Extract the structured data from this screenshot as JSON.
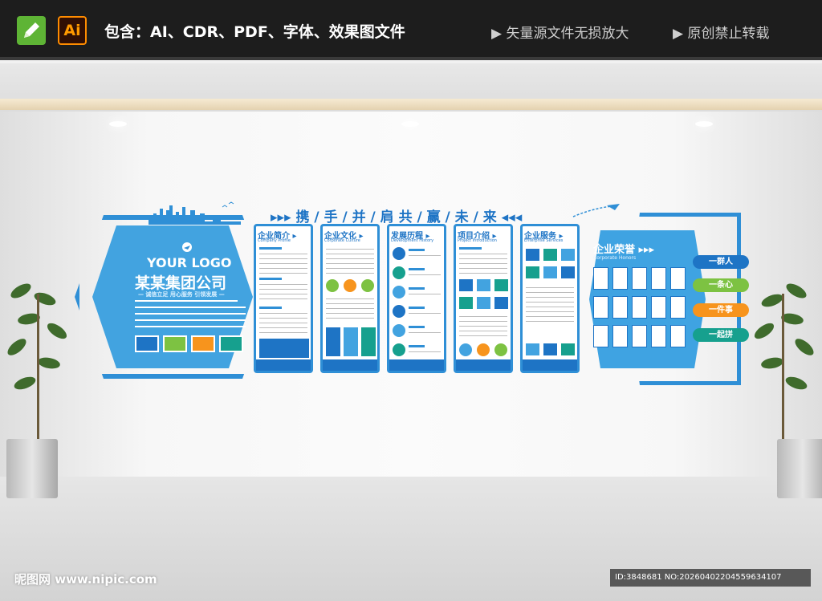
{
  "topbar": {
    "app_icon": "pen-icon",
    "ai_badge": "Ai",
    "includes_text": "包含：AI、CDR、PDF、字体、效果图文件",
    "note1": "▶ 矢量源文件无损放大",
    "note2": "▶ 原创禁止转载"
  },
  "wall": {
    "slogan_title": "▸▸▸ 携 / 手 / 并 / 肩 共 / 赢 / 未 / 来 ◂◂◂",
    "logo_text": "YOUR LOGO",
    "company_name": "某某集团公司",
    "company_slogan": "— 诚信立足 用心服务 引领发展 —",
    "panels": [
      {
        "title": "企业简介 ▸",
        "subtitle": "Company Profile"
      },
      {
        "title": "企业文化 ▸",
        "subtitle": "Corporate Culture"
      },
      {
        "title": "发展历程 ▸",
        "subtitle": "Development History"
      },
      {
        "title": "项目介绍 ▸",
        "subtitle": "Project Introduction"
      },
      {
        "title": "企业服务 ▸",
        "subtitle": "Enterprise Services"
      }
    ],
    "honors_title": "企业荣誉 ▸▸▸",
    "honors_subtitle": "Corporate Honors",
    "pills": [
      "一群人",
      "一条心",
      "一件事",
      "一起拼"
    ]
  },
  "colors": {
    "primary_blue": "#2f8fd6",
    "light_blue": "#42a3e0",
    "green": "#7dc242",
    "orange": "#f7941d",
    "teal": "#16a08e"
  },
  "watermark": {
    "site": "昵图网 www.nipic.com",
    "id_text": "ID:3848681 NO:20260402204559634107"
  }
}
